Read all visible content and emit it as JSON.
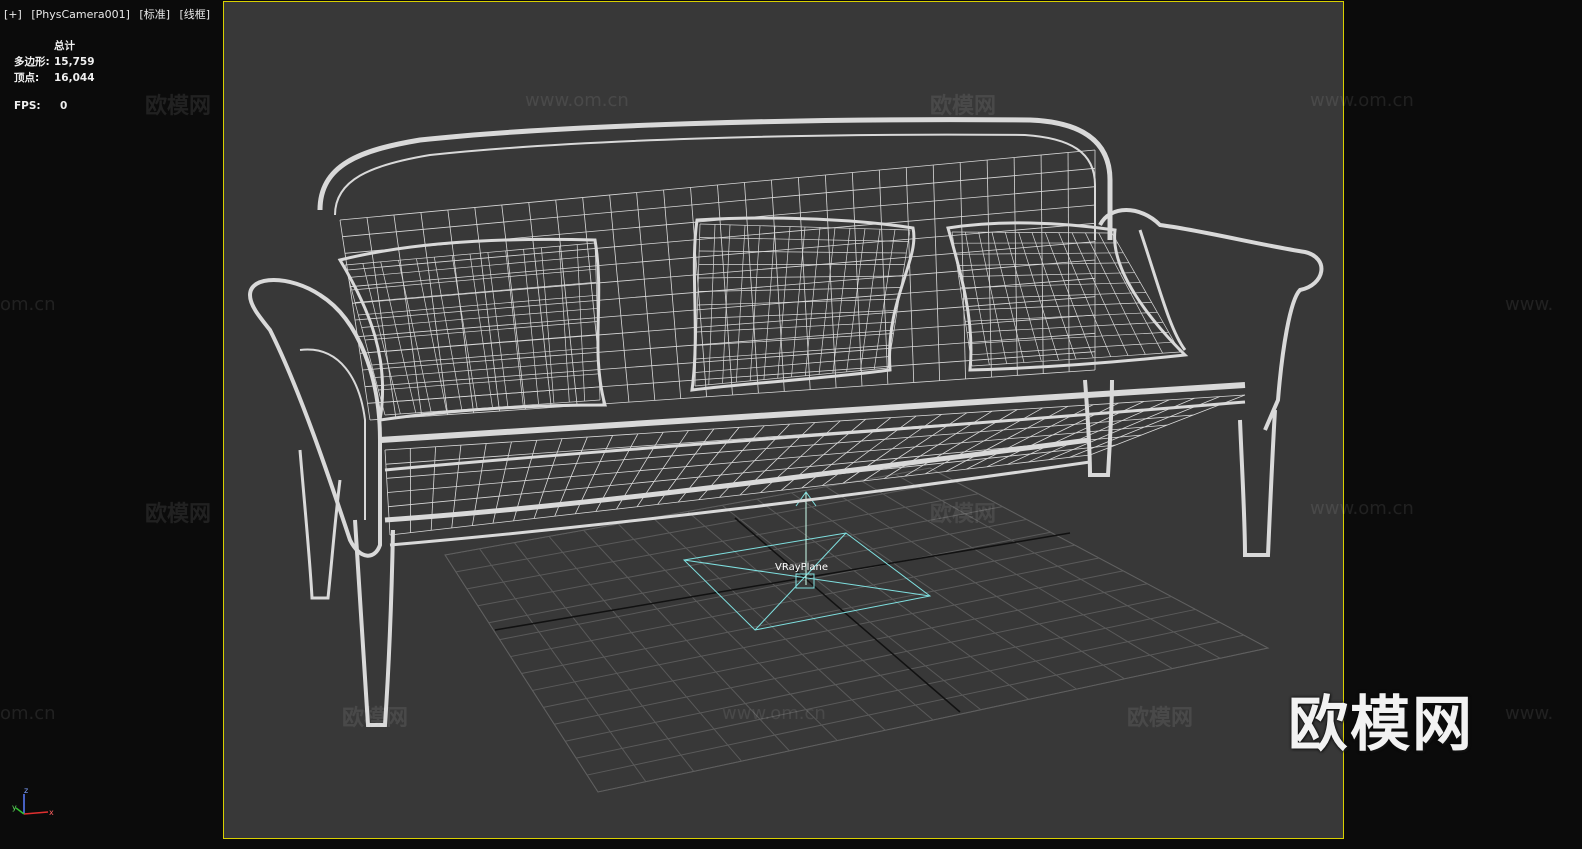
{
  "viewport": {
    "plus": "[+]",
    "camera": "[PhysCamera001]",
    "shading": "[标准]",
    "mode": "[线框]"
  },
  "stats": {
    "header": "总计",
    "polygons_label": "多边形:",
    "polygons_value": "15,759",
    "vertices_label": "顶点:",
    "vertices_value": "16,044"
  },
  "fps": {
    "label": "FPS:",
    "value": "0"
  },
  "helper": {
    "label": "VRayPlane"
  },
  "watermarks": {
    "brand": "欧模网",
    "url": "www.om.cn",
    "url_short": "om.cn",
    "url_prefix": "www."
  },
  "axis": {
    "x": "x",
    "y": "y",
    "z": "z"
  },
  "colors": {
    "frame": "#d8d000",
    "viewport_bg": "#383838",
    "wire": "#d9d9d9",
    "helper": "#7fe0e0"
  }
}
